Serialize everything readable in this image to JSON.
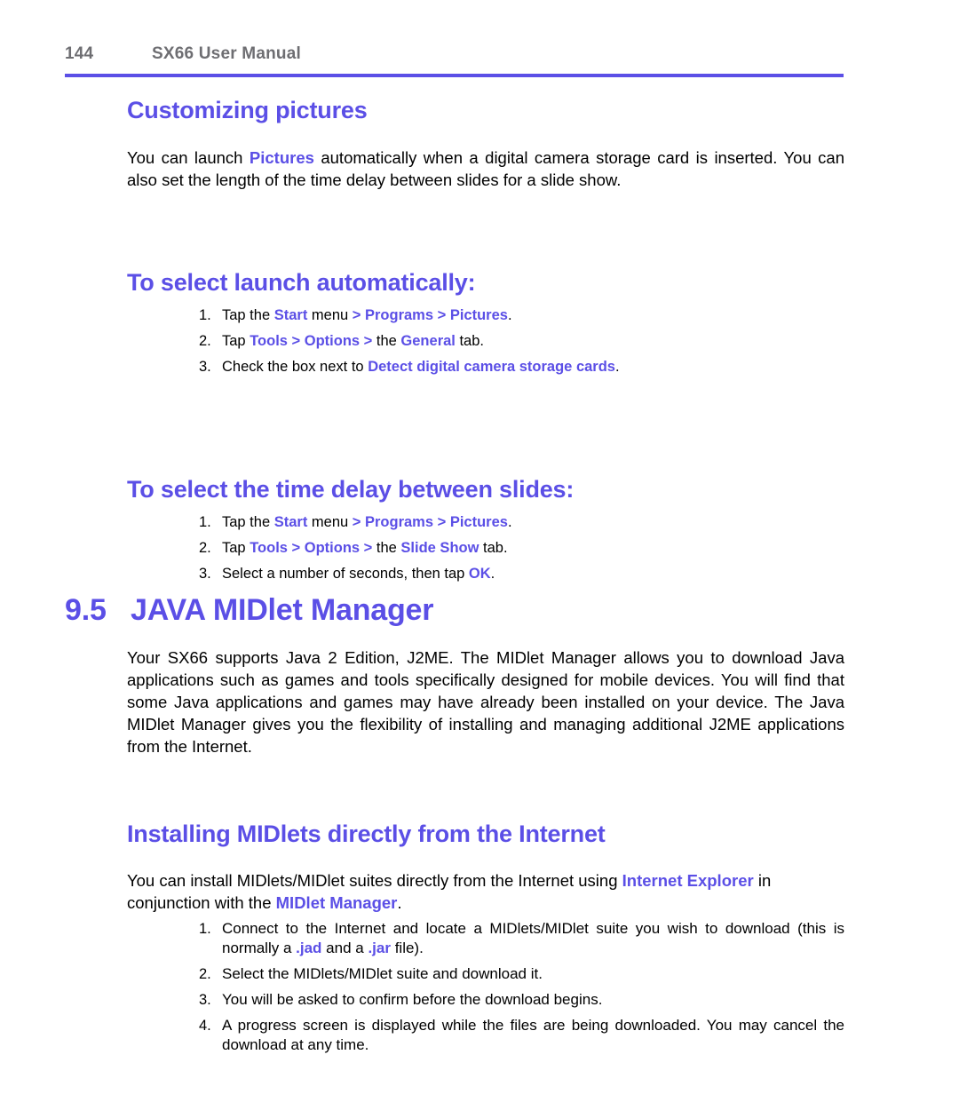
{
  "header": {
    "page_number": "144",
    "title": "SX66 User Manual",
    "rule_color": "#5b4fe6"
  },
  "colors": {
    "accent": "#5b4fe6",
    "header_text": "#6e6e72",
    "body_text": "#000000"
  },
  "sections": {
    "customizing_pictures": {
      "heading": "Customizing pictures",
      "paragraph_parts": {
        "p1": "You can launch ",
        "hl1": "Pictures",
        "p2": " automatically when a digital camera storage card is inserted. You can also set the length of the time delay between slides for a slide show."
      }
    },
    "select_launch": {
      "heading": "To select launch automatically:",
      "items": [
        {
          "num": "1.",
          "parts": {
            "a": "Tap the ",
            "b": "Start",
            "c": " menu ",
            "d": "> Programs > Pictures",
            "e": "."
          }
        },
        {
          "num": "2.",
          "parts": {
            "a": "Tap ",
            "b": "Tools > Options >",
            "c": " the ",
            "d": "General",
            "e": " tab."
          }
        },
        {
          "num": "3.",
          "parts": {
            "a": "Check the box next to ",
            "b": "Detect digital camera storage cards",
            "c": "."
          }
        }
      ]
    },
    "time_delay": {
      "heading": "To select the time delay between slides:",
      "items": [
        {
          "num": "1.",
          "parts": {
            "a": "Tap the ",
            "b": "Start",
            "c": " menu ",
            "d": "> Programs > Pictures",
            "e": "."
          }
        },
        {
          "num": "2.",
          "parts": {
            "a": "Tap ",
            "b": "Tools > Options >",
            "c": " the ",
            "d": "Slide Show",
            "e": " tab."
          }
        },
        {
          "num": "3.",
          "parts": {
            "a": "Select a number of seconds, then tap ",
            "b": "OK",
            "c": "."
          }
        }
      ]
    },
    "java_midlet_manager": {
      "section_number": "9.5",
      "heading": "JAVA MIDlet Manager",
      "paragraph": "Your SX66 supports Java 2 Edition, J2ME. The MIDlet Manager allows you to download Java applications such as games and tools specifically designed for mobile devices. You will find that some Java applications and games may have already been installed on your device. The Java MIDlet Manager gives you the flexibility of installing and managing additional J2ME applications from the Internet."
    },
    "installing_midlets": {
      "heading": "Installing MIDlets directly from the Internet",
      "paragraph_parts": {
        "p1": "You can install MIDlets/MIDlet suites directly from the Internet using ",
        "hl1": "Internet Explorer",
        "p2": " in conjunction with the ",
        "hl2": "MIDlet Manager",
        "p3": "."
      },
      "items": [
        {
          "num": "1.",
          "parts": {
            "a": "Connect to the Internet and locate a MIDlets/MIDlet suite you wish to download (this is normally a ",
            "b": ".jad",
            "c": " and a ",
            "d": ".jar",
            "e": " file)."
          }
        },
        {
          "num": "2.",
          "parts": {
            "a": "Select the MIDlets/MIDlet suite and download it.",
            "b": "",
            "c": "",
            "d": "",
            "e": ""
          }
        },
        {
          "num": "3.",
          "parts": {
            "a": "You will be asked to confirm before the download begins.",
            "b": "",
            "c": "",
            "d": "",
            "e": ""
          }
        },
        {
          "num": "4.",
          "parts": {
            "a": "A progress screen is displayed while the files are being downloaded. You may cancel the download at any time.",
            "b": "",
            "c": "",
            "d": "",
            "e": ""
          }
        }
      ]
    }
  }
}
